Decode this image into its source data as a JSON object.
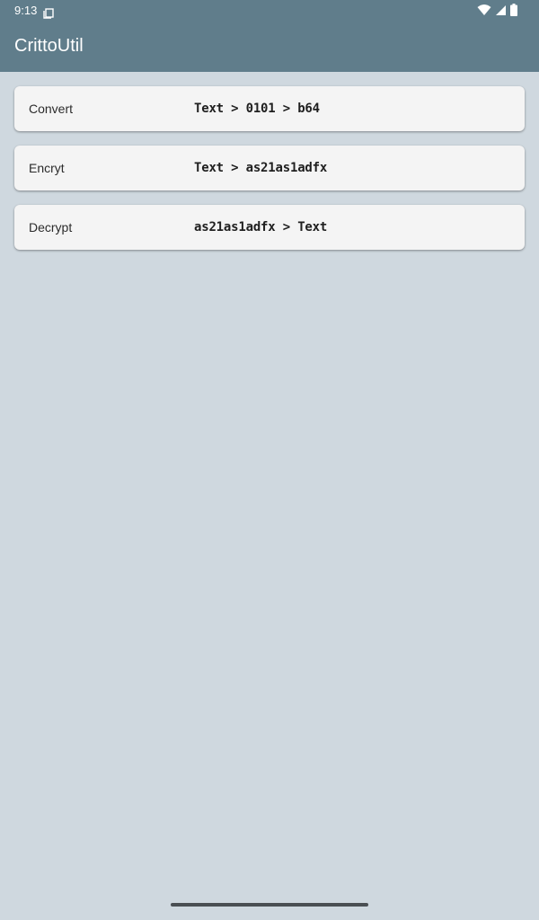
{
  "status_bar": {
    "time": "9:13",
    "icons": [
      "sim-card-icon",
      "wifi-icon",
      "signal-icon",
      "battery-icon"
    ]
  },
  "app_bar": {
    "title": "CrittoUtil"
  },
  "items": [
    {
      "label": "Convert",
      "description": "Text > 0101 > b64"
    },
    {
      "label": "Encryt",
      "description": "Text > as21as1adfx"
    },
    {
      "label": "Decrypt",
      "description": "as21as1adfx > Text"
    }
  ],
  "colors": {
    "primary": "#607d8b",
    "background": "#cfd8df",
    "card": "#f4f4f4"
  }
}
